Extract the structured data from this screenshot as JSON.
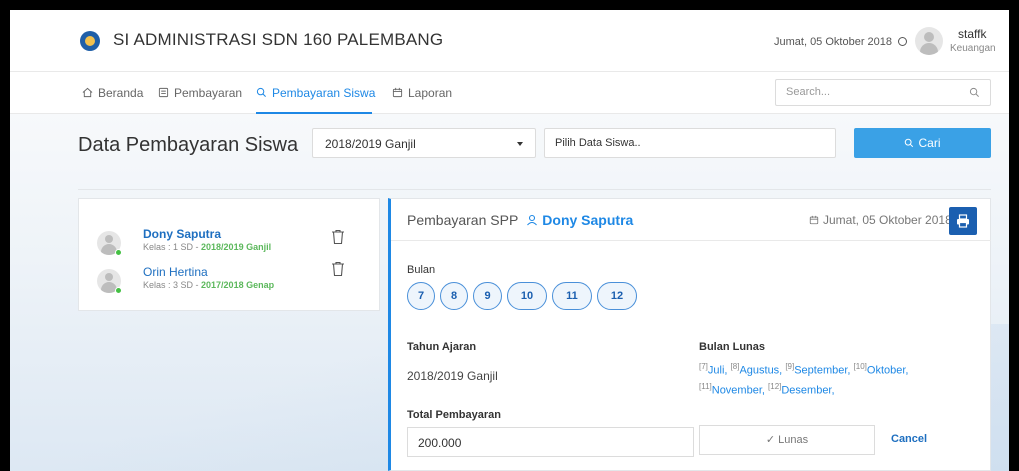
{
  "header": {
    "title": "SI ADMINISTRASI SDN 160 PALEMBANG",
    "date": "Jumat, 05 Oktober 2018",
    "user_name": "staffk",
    "user_role": "Keuangan"
  },
  "nav": {
    "items": [
      {
        "label": "Beranda",
        "icon": "home-icon"
      },
      {
        "label": "Pembayaran",
        "icon": "list-icon"
      },
      {
        "label": "Pembayaran Siswa",
        "icon": "search-icon"
      },
      {
        "label": "Laporan",
        "icon": "calendar-icon"
      }
    ],
    "active": "Pembayaran Siswa",
    "search_placeholder": "Search..."
  },
  "page": {
    "title": "Data Pembayaran Siswa",
    "semester_selected": "2018/2019 Ganjil",
    "student_placeholder": "Pilih Data Siswa..",
    "search_button": "Cari"
  },
  "students": [
    {
      "name": "Dony Saputra",
      "class": "Kelas : 1 SD - ",
      "year": "2018/2019 Ganjil",
      "status": "online"
    },
    {
      "name": "Orin Hertina",
      "class": "Kelas : 3 SD - ",
      "year": "2017/2018 Genap",
      "status": "online"
    }
  ],
  "panel": {
    "title": "Pembayaran SPP",
    "student": "Dony Saputra",
    "date": "Jumat, 05 Oktober 2018",
    "bulan_label": "Bulan",
    "months": [
      "7",
      "8",
      "9",
      "10",
      "11",
      "12"
    ],
    "tahun_label": "Tahun Ajaran",
    "tahun_value": "2018/2019 Ganjil",
    "lunas_label": "Bulan Lunas",
    "lunas_months": [
      {
        "num": "[7]",
        "name": "Juli,"
      },
      {
        "num": "[8]",
        "name": "Agustus,"
      },
      {
        "num": "[9]",
        "name": "September,"
      },
      {
        "num": "[10]",
        "name": "Oktober,"
      },
      {
        "num": "[11]",
        "name": "November,"
      },
      {
        "num": "[12]",
        "name": "Desember,"
      }
    ],
    "total_label": "Total Pembayaran",
    "total_value": "200.000",
    "lunas_button": "Lunas",
    "cancel_button": "Cancel"
  },
  "colors": {
    "accent": "#1e88e5",
    "button_blue": "#3aa1e6",
    "print_button": "#1b5fb0",
    "year_green": "#5cb85c"
  }
}
